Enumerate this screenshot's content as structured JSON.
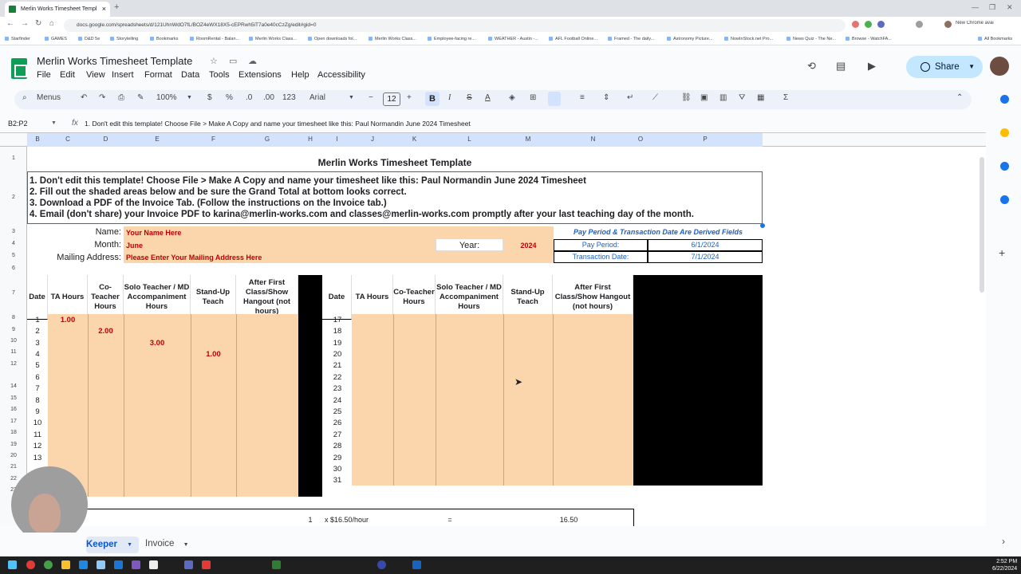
{
  "browser": {
    "tab_title": "Merlin Works Timesheet Templ",
    "url": "docs.google.com/spreadsheets/d/121UhnWdO7fL/BOZ4eWX18X5-cEPRwh5iT7a0e40cCzZg/edit#gid=0",
    "bookmarks": [
      "Starfinder",
      "GAMES",
      "D&D 5e",
      "Storytelling",
      "Bookmarks",
      "RoomRental - Balan...",
      "Merlin Works Class...",
      "Open downloads fol...",
      "Merlin Works Class...",
      "Employee-facing re...",
      "WEATHER - Austin -...",
      "AFL Football Online...",
      "Framed - The daily...",
      "Astronomy Picture...",
      "NowInStock.net Pro...",
      "News Quiz - The Ne...",
      "Browse - WatchFA...",
      "All Bookmarks"
    ],
    "update_badge": "New Chrome available"
  },
  "doc": {
    "title": "Merlin Works Timesheet Template",
    "menu": [
      "File",
      "Edit",
      "View",
      "Insert",
      "Format",
      "Data",
      "Tools",
      "Extensions",
      "Help",
      "Accessibility"
    ],
    "share_label": "Share"
  },
  "toolbar": {
    "menus_label": "Menus",
    "zoom": "100%",
    "currency": "$",
    "percent": "%",
    "dec_less": ".0",
    "dec_more": ".00",
    "format_123": "123",
    "font": "Arial",
    "font_size": "12",
    "bold": "B",
    "italic": "I"
  },
  "formula_bar": {
    "name_box": "B2:P2",
    "fx": "fx",
    "content": "1. Don't edit this template! Choose File > Make A Copy and name your timesheet like this: Paul Normandin June 2024 Timesheet"
  },
  "columns": [
    "B",
    "C",
    "D",
    "E",
    "F",
    "G",
    "H",
    "I",
    "J",
    "K",
    "L",
    "M",
    "N",
    "O",
    "P"
  ],
  "rows": [
    "1",
    "2",
    "3",
    "4",
    "5",
    "6",
    "7",
    "8",
    "9",
    "10",
    "11",
    "12",
    "14",
    "15",
    "16",
    "17",
    "18",
    "19",
    "20",
    "21",
    "22",
    "23"
  ],
  "sheet": {
    "title": "Merlin Works Timesheet Template",
    "instructions": [
      "1. Don't edit this template! Choose File > Make A Copy and name your timesheet like this: Paul Normandin June 2024 Timesheet",
      "2. Fill out the shaded areas below and be sure the Grand Total at bottom looks correct.",
      "3. Download a PDF of the Invoice Tab. (Follow the instructions on the Invoice tab.)",
      "4. Email (don't share) your Invoice PDF to karina@merlin-works.com and classes@merlin-works.com promptly after your last teaching day of the month."
    ],
    "name_label": "Name:",
    "name_value": "Your Name Here",
    "month_label": "Month:",
    "month_value": "June",
    "mailing_label": "Mailing Address:",
    "mailing_value": "Please Enter Your Mailing Address Here",
    "year_label": "Year:",
    "year_value": "2024",
    "derived_note": "Pay Period & Transaction Date Are Derived Fields",
    "pay_period_label": "Pay Period:",
    "pay_period_value": "6/1/2024",
    "transaction_label": "Transaction Date:",
    "transaction_value": "7/1/2024",
    "headers": [
      "Date",
      "TA Hours",
      "Co-Teacher Hours",
      "Solo Teacher / MD Accompaniment Hours",
      "Stand-Up Teach",
      "After First Class/Show Hangout (not hours)"
    ],
    "left_dates": [
      "1",
      "2",
      "3",
      "4",
      "5",
      "6",
      "7",
      "8",
      "9",
      "10",
      "11",
      "12",
      "13"
    ],
    "right_dates": [
      "17",
      "18",
      "19",
      "20",
      "21",
      "22",
      "23",
      "24",
      "25",
      "26",
      "27",
      "28",
      "29",
      "30",
      "31"
    ],
    "entries": {
      "ta_row1": "1.00",
      "co_row2": "2.00",
      "solo_row3": "3.00",
      "standup_row4": "1.00"
    },
    "summary": {
      "qty": "1",
      "rate": "x $16.50/hour",
      "eq": "=",
      "total": "16.50"
    }
  },
  "sheet_tabs": [
    "Keeper",
    "Invoice"
  ],
  "clock": {
    "time": "2:52 PM",
    "date": "6/22/2024"
  }
}
